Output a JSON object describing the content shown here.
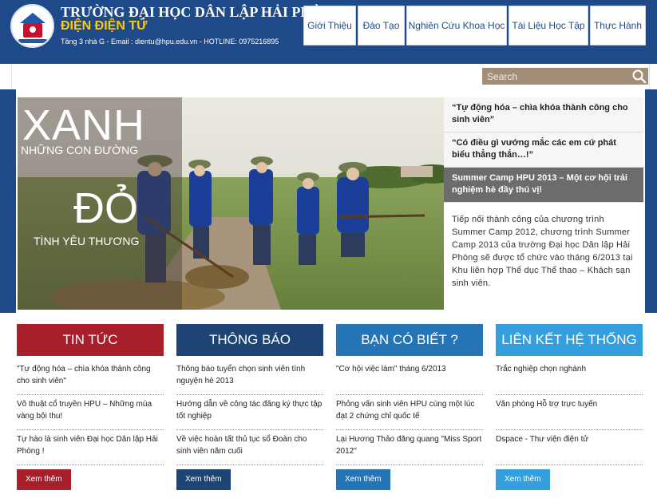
{
  "header": {
    "univ_name": "TRƯỜNG ĐẠI HỌC DÂN LẬP HẢI PHÒNG",
    "dept_name": "ĐIỆN ĐIỆN TỬ",
    "contact": "Tầng 3 nhà G - Email : dientu@hpu.edu.vn - HOTLINE: 0975216895"
  },
  "nav": {
    "items": [
      "Giới Thiệu",
      "Đào Tạo",
      "Nghiên Cứu Khoa Học",
      "Tài Liệu Học Tập",
      "Thực Hành"
    ]
  },
  "search": {
    "placeholder": "Search"
  },
  "slider": {
    "image_text": {
      "xanh": "XANH",
      "xanh_sub": "NHỮNG CON ĐƯỜNG",
      "do": "ĐỎ",
      "do_sub": "TÌNH YÊU THƯƠNG"
    },
    "items": [
      "“Tự động hóa – chìa khóa thành công cho sinh viên”",
      "“Có điều gì vướng mắc các em cứ phát biểu thẳng thắn…!”",
      "Summer Camp HPU 2013 – Một cơ hội trải nghiệm hè đầy thú vị!"
    ],
    "active_description": "Tiếp nối thành công của chương trình Summer Camp 2012, chương trình Summer Camp 2013 của trường Đại học Dân lập Hải Phòng sẽ được tổ chức vào tháng 6/2013 tại Khu liên hợp Thể dục Thể thao – Khách sạn sinh viên."
  },
  "columns": [
    {
      "title": "TIN TỨC",
      "color": "#a61f2a",
      "items": [
        "\"Tự động hóa – chìa khóa thành công cho sinh viên\"",
        "Võ thuật cổ truyền HPU – Những mùa vàng bội thu!",
        "Tự hào là sinh viên Đại học Dân lập Hải Phòng !"
      ],
      "more": "Xem thêm"
    },
    {
      "title": "THÔNG BÁO",
      "color": "#1d4474",
      "items": [
        "Thông báo tuyển chọn sinh viên tình nguyện hè 2013",
        "Hướng dẫn về công tác đăng ký thực tập tốt nghiệp",
        "Về việc hoàn tất thủ tục sổ Đoàn cho sinh viên năm cuối"
      ],
      "more": "Xem thêm"
    },
    {
      "title": "BẠN CÓ BIẾT ?",
      "color": "#2574b8",
      "items": [
        "\"Cơ hội việc làm\" tháng 6/2013",
        "Phỏng vấn sinh viên HPU cùng một lúc đạt 2 chứng chỉ quốc tế",
        "Lại Hương Thảo đăng quang \"Miss Sport 2012\""
      ],
      "more": "Xem thêm"
    },
    {
      "title": "LIÊN KẾT HỆ THỐNG",
      "color": "#33a0dd",
      "items": [
        "Trắc nghiệp chọn nghành",
        "Văn phòng Hỗ trợ trực tuyến",
        "Dspace - Thư viện điện tử"
      ],
      "more": "Xem thêm"
    }
  ]
}
